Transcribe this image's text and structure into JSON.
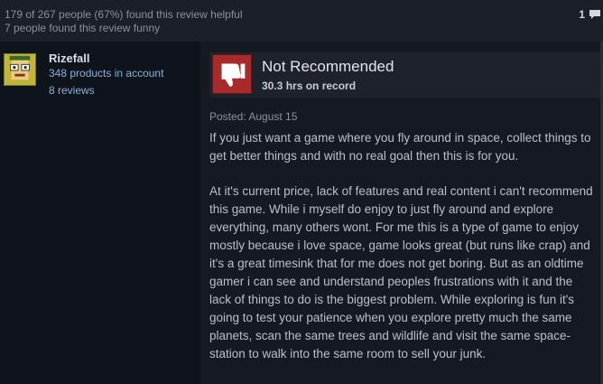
{
  "stats": {
    "helpful": "179 of 267 people (67%) found this review helpful",
    "funny": "7 people found this review funny",
    "comment_count": "1"
  },
  "author": {
    "name": "Rizefall",
    "products": "348 products in account",
    "reviews": "8 reviews"
  },
  "review": {
    "verdict": "Not Recommended",
    "hours": "30.3 hrs on record",
    "posted": "Posted: August 15",
    "paragraph1": "If you just want a game where you fly around in space, collect things to get better things and with no real goal then this is for you.",
    "paragraph2": "At it's current price, lack of features and real content i can't recommend this game. While i myself do enjoy to just fly around and explore everything, many others wont. For me this is a type of game to enjoy mostly because i love space, game looks great (but runs like crap) and it's a great timesink that for me does not get boring. But as an oldtime gamer i can see and understand peoples frustrations with it and the lack of things to do is the biggest problem. While exploring is fun it's going to test your patience when you explore pretty much the same planets, scan the same trees and wildlife and visit the same space-station to walk into the same room to sell your junk."
  },
  "icons": {
    "thumb": "thumbs-down-icon",
    "comment": "comment-icon",
    "avatar": "avatar-pixel-face"
  },
  "colors": {
    "thumb_bg": "#a82a2a",
    "link": "#7fb5e3"
  }
}
